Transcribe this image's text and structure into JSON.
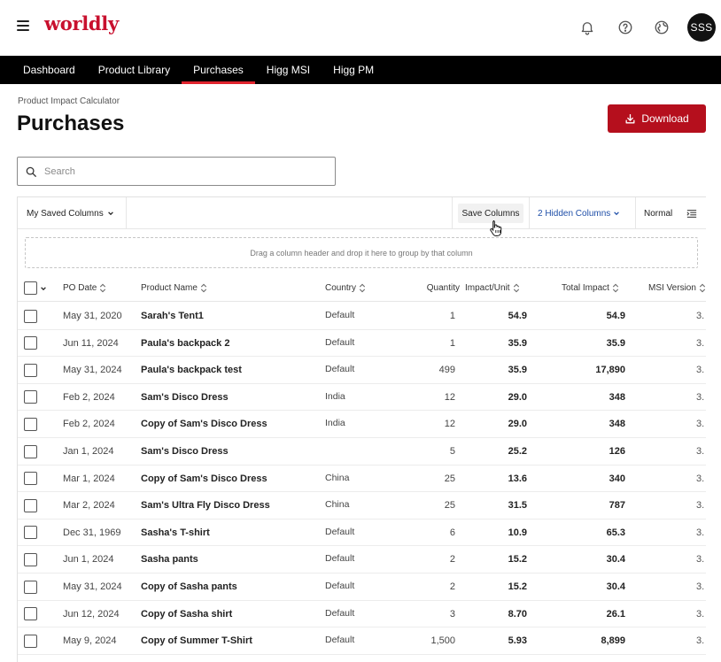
{
  "app": {
    "logo": "worldly",
    "avatar_initials": "SSS",
    "icons": [
      "menu-icon",
      "bell-icon",
      "help-icon",
      "globe-icon"
    ]
  },
  "nav": {
    "items": [
      {
        "label": "Dashboard"
      },
      {
        "label": "Product Library"
      },
      {
        "label": "Purchases"
      },
      {
        "label": "Higg MSI"
      },
      {
        "label": "Higg PM"
      }
    ],
    "active": "Purchases"
  },
  "page": {
    "breadcrumb": "Product Impact Calculator",
    "title": "Purchases",
    "download_label": "Download"
  },
  "search": {
    "placeholder": "Search",
    "value": ""
  },
  "toolbar": {
    "saved_columns_label": "My Saved Columns",
    "save_columns_label": "Save Columns",
    "hidden_columns_label": "2 Hidden Columns",
    "density_label": "Normal"
  },
  "grid": {
    "group_hint": "Drag a column header and drop it here to group by that column",
    "columns": [
      {
        "label": "PO Date"
      },
      {
        "label": "Product Name"
      },
      {
        "label": "Country"
      },
      {
        "label": "Quantity"
      },
      {
        "label": "Impact/Unit"
      },
      {
        "label": "Total Impact"
      },
      {
        "label": "MSI Version"
      }
    ],
    "rows": [
      {
        "po_date": "May 31, 2020",
        "product": "Sarah's Tent1",
        "country": "Default",
        "quantity": "1",
        "impact_unit": "54.9",
        "total": "54.9",
        "msi": "3."
      },
      {
        "po_date": "Jun 11, 2024",
        "product": "Paula's backpack 2",
        "country": "Default",
        "quantity": "1",
        "impact_unit": "35.9",
        "total": "35.9",
        "msi": "3."
      },
      {
        "po_date": "May 31, 2024",
        "product": "Paula's backpack test",
        "country": "Default",
        "quantity": "499",
        "impact_unit": "35.9",
        "total": "17,890",
        "msi": "3."
      },
      {
        "po_date": "Feb 2, 2024",
        "product": "Sam's Disco Dress",
        "country": "India",
        "quantity": "12",
        "impact_unit": "29.0",
        "total": "348",
        "msi": "3."
      },
      {
        "po_date": "Feb 2, 2024",
        "product": "Copy of Sam's Disco Dress",
        "country": "India",
        "quantity": "12",
        "impact_unit": "29.0",
        "total": "348",
        "msi": "3."
      },
      {
        "po_date": "Jan 1, 2024",
        "product": "Sam's Disco Dress",
        "country": "",
        "quantity": "5",
        "impact_unit": "25.2",
        "total": "126",
        "msi": "3."
      },
      {
        "po_date": "Mar 1, 2024",
        "product": "Copy of Sam's Disco Dress",
        "country": "China",
        "quantity": "25",
        "impact_unit": "13.6",
        "total": "340",
        "msi": "3."
      },
      {
        "po_date": "Mar 2, 2024",
        "product": "Sam's Ultra Fly Disco Dress",
        "country": "China",
        "quantity": "25",
        "impact_unit": "31.5",
        "total": "787",
        "msi": "3."
      },
      {
        "po_date": "Dec 31, 1969",
        "product": "Sasha's T-shirt",
        "country": "Default",
        "quantity": "6",
        "impact_unit": "10.9",
        "total": "65.3",
        "msi": "3."
      },
      {
        "po_date": "Jun 1, 2024",
        "product": "Sasha pants",
        "country": "Default",
        "quantity": "2",
        "impact_unit": "15.2",
        "total": "30.4",
        "msi": "3."
      },
      {
        "po_date": "May 31, 2024",
        "product": "Copy of Sasha pants",
        "country": "Default",
        "quantity": "2",
        "impact_unit": "15.2",
        "total": "30.4",
        "msi": "3."
      },
      {
        "po_date": "Jun 12, 2024",
        "product": "Copy of Sasha shirt",
        "country": "Default",
        "quantity": "3",
        "impact_unit": "8.70",
        "total": "26.1",
        "msi": "3."
      },
      {
        "po_date": "May 9, 2024",
        "product": "Copy of Summer T-Shirt",
        "country": "Default",
        "quantity": "1,500",
        "impact_unit": "5.93",
        "total": "8,899",
        "msi": "3."
      }
    ]
  },
  "colors": {
    "brand": "#c8102e",
    "button": "#b50f1d",
    "nav_bg": "#000000",
    "active_underline": "#e0242e",
    "link": "#1f4fa8"
  }
}
